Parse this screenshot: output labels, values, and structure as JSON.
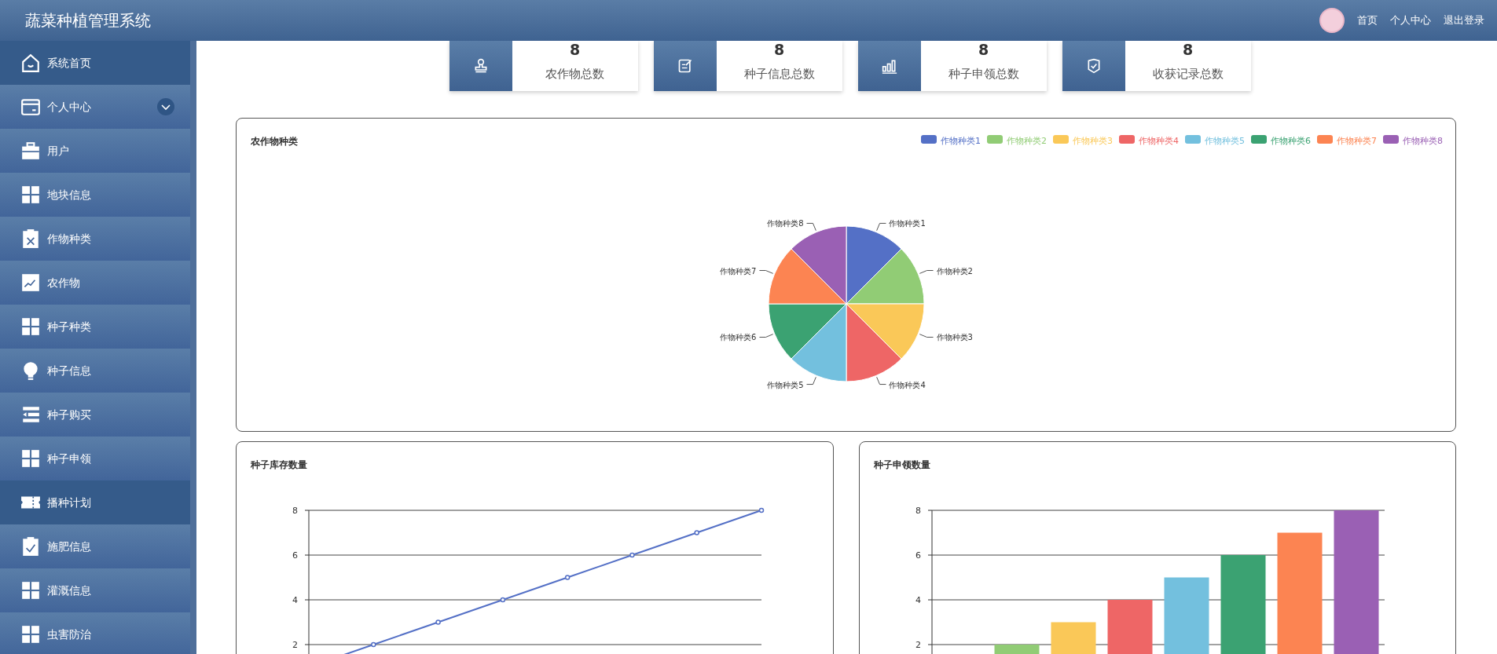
{
  "header": {
    "title": "蔬菜种植管理系统",
    "links": [
      "首页",
      "个人中心",
      "退出登录"
    ]
  },
  "sidebar": {
    "items": [
      {
        "label": "系统首页",
        "kind": "link",
        "selected": true
      },
      {
        "label": "个人中心",
        "kind": "group",
        "selected": false,
        "expanded": false
      },
      {
        "label": "用户",
        "kind": "link",
        "selected": false
      },
      {
        "label": "地块信息",
        "kind": "link",
        "selected": false
      },
      {
        "label": "作物种类",
        "kind": "link",
        "selected": false
      },
      {
        "label": "农作物",
        "kind": "link",
        "selected": false
      },
      {
        "label": "种子种类",
        "kind": "link",
        "selected": false
      },
      {
        "label": "种子信息",
        "kind": "link",
        "selected": false
      },
      {
        "label": "种子购买",
        "kind": "link",
        "selected": false
      },
      {
        "label": "种子申领",
        "kind": "link",
        "selected": false
      },
      {
        "label": "播种计划",
        "kind": "link",
        "selected": true
      },
      {
        "label": "施肥信息",
        "kind": "link",
        "selected": false
      },
      {
        "label": "灌溉信息",
        "kind": "link",
        "selected": false
      },
      {
        "label": "虫害防治",
        "kind": "link",
        "selected": false
      }
    ]
  },
  "stats": [
    {
      "value": "8",
      "label": "农作物总数"
    },
    {
      "value": "8",
      "label": "种子信息总数"
    },
    {
      "value": "8",
      "label": "种子申领总数"
    },
    {
      "value": "8",
      "label": "收获记录总数"
    }
  ],
  "charts": [
    {
      "chart_data": {
        "type": "pie",
        "title": "农作物种类",
        "annotations": [
          {
            "text": "作物种类1"
          },
          {
            "text": "作物种类2"
          },
          {
            "text": "作物种类3"
          },
          {
            "text": "作物种类4"
          },
          {
            "text": "作物种类5"
          },
          {
            "text": "作物种类6"
          },
          {
            "text": "作物种类7"
          },
          {
            "text": "作物种类8"
          }
        ],
        "categories": [
          "作物种类1",
          "作物种类2",
          "作物种类3",
          "作物种类4",
          "作物种类5",
          "作物种类6",
          "作物种类7",
          "作物种类8"
        ],
        "values": [
          1,
          1,
          1,
          1,
          1,
          1,
          1,
          1
        ],
        "colors": [
          "#5470c6",
          "#91cc75",
          "#fac858",
          "#ee6666",
          "#73c0de",
          "#3ba272",
          "#fc8452",
          "#9a60b4"
        ]
      }
    },
    {
      "chart_data": {
        "type": "line",
        "title": "种子库存数量",
        "grid": true,
        "ylim": [
          0,
          8
        ],
        "yticks": [
          2,
          4,
          6,
          8
        ],
        "series": [
          {
            "color": "#5470c6",
            "marker": "circle",
            "values": [
              1,
              2,
              3,
              4,
              5,
              6,
              7,
              8
            ]
          }
        ]
      }
    },
    {
      "chart_data": {
        "type": "bar",
        "title": "种子申领数量",
        "grid": true,
        "ylim": [
          0,
          8
        ],
        "yticks": [
          2,
          4,
          6,
          8
        ],
        "values": [
          null,
          2,
          3,
          4,
          5,
          6,
          7,
          8
        ]
      }
    }
  ]
}
